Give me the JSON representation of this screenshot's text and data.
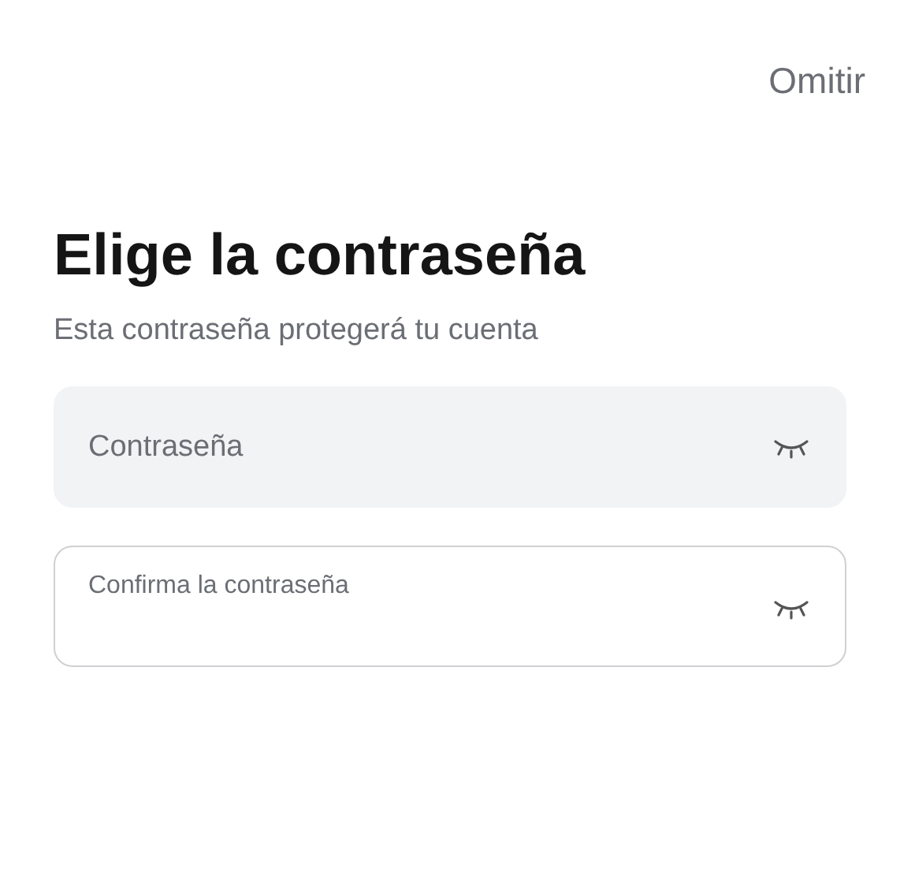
{
  "skip_button": "Omitir",
  "title": "Elige la contraseña",
  "subtitle": "Esta contraseña protegerá tu cuenta",
  "fields": [
    {
      "placeholder": "Contraseña",
      "focused": false
    },
    {
      "placeholder": "Confirma la contraseña",
      "focused": true
    }
  ]
}
